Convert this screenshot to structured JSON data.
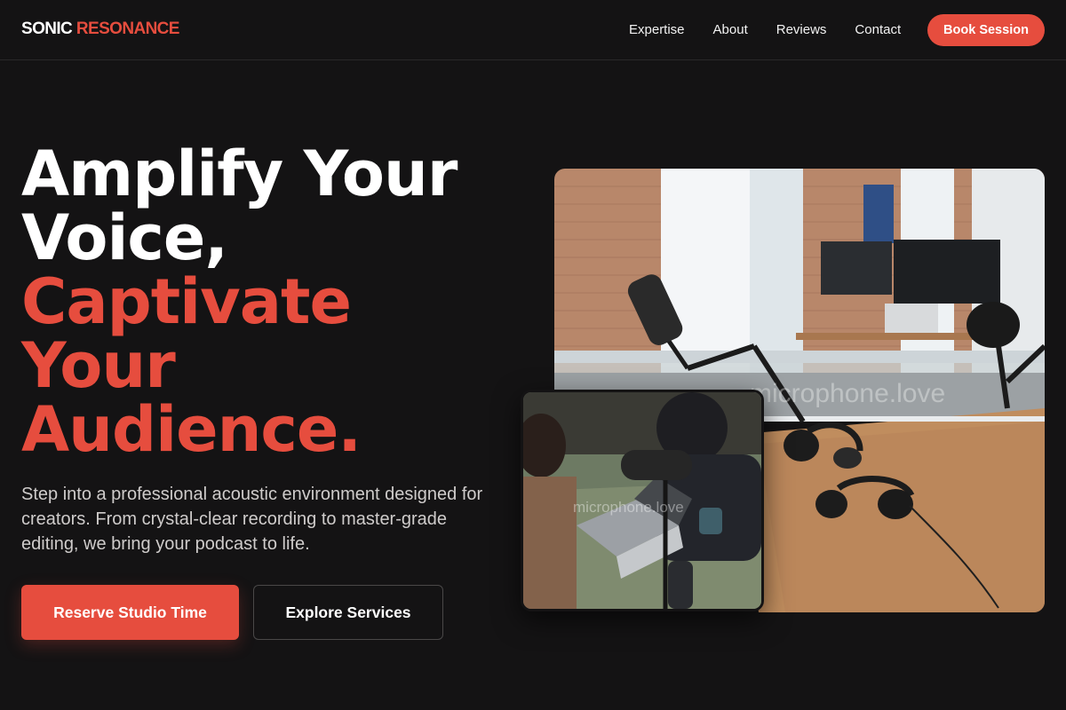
{
  "brand": {
    "part1": "SONIC",
    "part2": "RESONANCE"
  },
  "nav": {
    "links": [
      "Expertise",
      "About",
      "Reviews",
      "Contact"
    ],
    "cta": "Book Session"
  },
  "hero": {
    "headline_white": [
      "Amplify Your",
      "Voice,"
    ],
    "headline_red": [
      "Captivate",
      "Your",
      "Audience."
    ],
    "description": "Step into a professional acoustic environment designed for creators. From crystal-clear recording to master-grade editing, we bring your podcast to life.",
    "primary_button": "Reserve Studio Time",
    "secondary_button": "Explore Services"
  },
  "images": {
    "main": {
      "watermark": "microphone.love",
      "subject": "podcast studio with microphones and headphones on wooden table"
    },
    "inset": {
      "watermark": "microphone.love",
      "subject": "two people recording a podcast with laptop and microphone"
    }
  },
  "colors": {
    "accent": "#e64d3e",
    "background": "#141314"
  }
}
